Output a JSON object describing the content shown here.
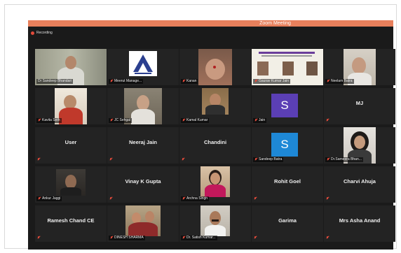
{
  "window": {
    "title": "Zoom Meeting",
    "recording_label": "Recording"
  },
  "colors": {
    "titlebar": "#e8805c",
    "active_border": "#c8e000",
    "mic_muted": "#e24b3b",
    "avatar_purple": "#5b3fb5",
    "avatar_blue": "#1e88d6"
  },
  "tiles": [
    {
      "name": "Dr Sandeep Bhandari",
      "kind": "video",
      "active": true,
      "muted": false
    },
    {
      "name": "Meerut Manage...",
      "kind": "logo",
      "muted": true
    },
    {
      "name": "Kanan",
      "kind": "video",
      "muted": true
    },
    {
      "name": "Gaurav Kumar Jain",
      "kind": "poster",
      "muted": true
    },
    {
      "name": "Neelam Batra",
      "kind": "video",
      "muted": true
    },
    {
      "name": "Kavita Seth",
      "kind": "video",
      "muted": true
    },
    {
      "name": "JC Sehgal",
      "kind": "video",
      "muted": true
    },
    {
      "name": "Kamal Kumar",
      "kind": "video",
      "muted": true
    },
    {
      "name": "Jain",
      "kind": "avatar",
      "initial": "S",
      "muted": true
    },
    {
      "name": "MJ",
      "kind": "name",
      "muted": true
    },
    {
      "name": "User",
      "kind": "name",
      "muted": true
    },
    {
      "name": "Neeraj Jain",
      "kind": "name",
      "muted": true
    },
    {
      "name": "Chandini",
      "kind": "name",
      "muted": true
    },
    {
      "name": "Sandeep Batra",
      "kind": "avatar",
      "initial": "S",
      "muted": true
    },
    {
      "name": "Dr.Sameera Bhan...",
      "kind": "video",
      "muted": true
    },
    {
      "name": "Ankur Jaggi",
      "kind": "video",
      "muted": true
    },
    {
      "name": "Vinay K Gupta",
      "kind": "name",
      "muted": true
    },
    {
      "name": "Archna Singh",
      "kind": "video",
      "muted": true
    },
    {
      "name": "Rohit Goel",
      "kind": "name",
      "muted": true
    },
    {
      "name": "Charvi Ahuja",
      "kind": "name",
      "muted": true
    },
    {
      "name": "Ramesh Chand CE",
      "kind": "name",
      "muted": true
    },
    {
      "name": "DINESH SHARMA",
      "kind": "video",
      "muted": true
    },
    {
      "name": "Dr. Satish Kumar...",
      "kind": "video",
      "muted": true
    },
    {
      "name": "Garima",
      "kind": "name",
      "muted": true
    },
    {
      "name": "Mrs Asha Anand",
      "kind": "name",
      "muted": true
    }
  ]
}
